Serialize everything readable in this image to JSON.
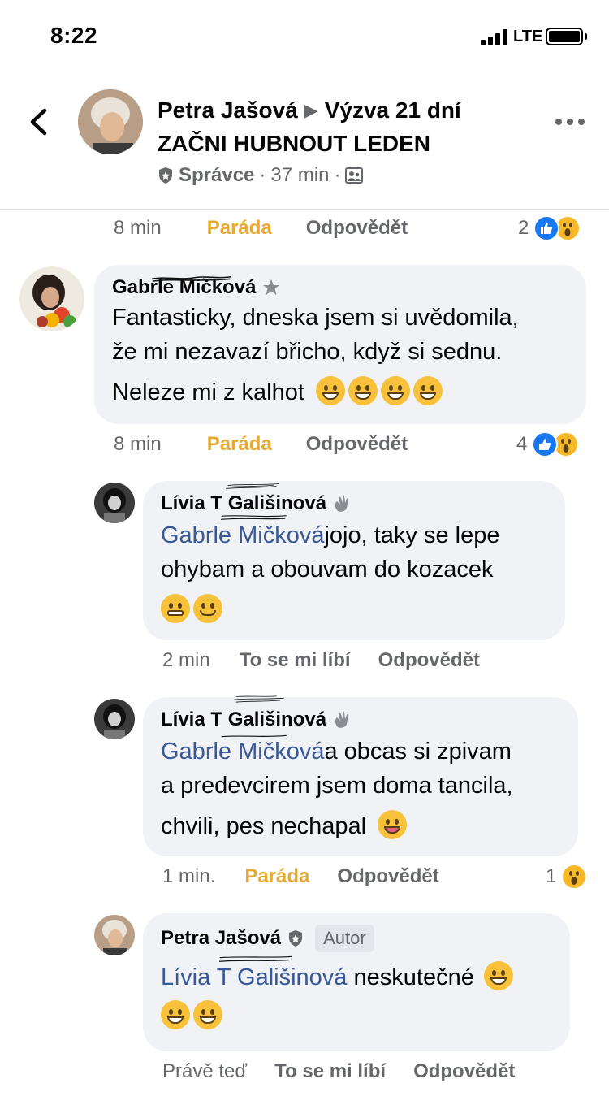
{
  "status_bar": {
    "time": "8:22",
    "network": "LTE"
  },
  "header": {
    "author": "Petra Jašová",
    "group": "Výzva 21 dní",
    "group_line2": "ZAČNI HUBNOUT LEDEN",
    "role": "Správce",
    "time": "37 min",
    "separator": "·"
  },
  "top_actions": {
    "time": "8 min",
    "react": "Paráda",
    "reply": "Odpovědět",
    "reaction_count": "2"
  },
  "comments": [
    {
      "author": "Gabrle Mičková",
      "text_line1": "Fantasticky, dneska jsem si uvědomila,",
      "text_line2": "že mi nezavazí břicho, když si sednu.",
      "text_line3": "Neleze mi z kalhot",
      "time": "8 min",
      "react": "Paráda",
      "reply": "Odpovědět",
      "reaction_count": "4"
    },
    {
      "author": "Lívia T Gališinová",
      "mention": "Gabrle Mičková",
      "text_line1": "jojo, taky se lepe",
      "text_line2": "ohybam a obouvam do kozacek",
      "time": "2 min",
      "react": "To se mi líbí",
      "reply": "Odpovědět"
    },
    {
      "author": "Lívia T Gališinová",
      "mention": "Gabrle Mičková",
      "text_line1": "a obcas si zpivam",
      "text_line2": "a predevcirem jsem doma tancila,",
      "text_line3": "chvili, pes nechapal",
      "time": "1 min.",
      "react": "Paráda",
      "reply": "Odpovědět",
      "reaction_count": "1"
    },
    {
      "author": "Petra Jašová",
      "badge": "Autor",
      "mention": "Lívia T Gališinová",
      "text_line1": "neskutečné",
      "time": "Právě teď",
      "react": "To se mi líbí",
      "reply": "Odpovědět"
    }
  ],
  "colors": {
    "link": "#385898",
    "gold": "#e8a930",
    "grey": "#65676b",
    "bubble": "#f0f2f5",
    "like": "#1877f2",
    "wow": "#f7b928"
  }
}
